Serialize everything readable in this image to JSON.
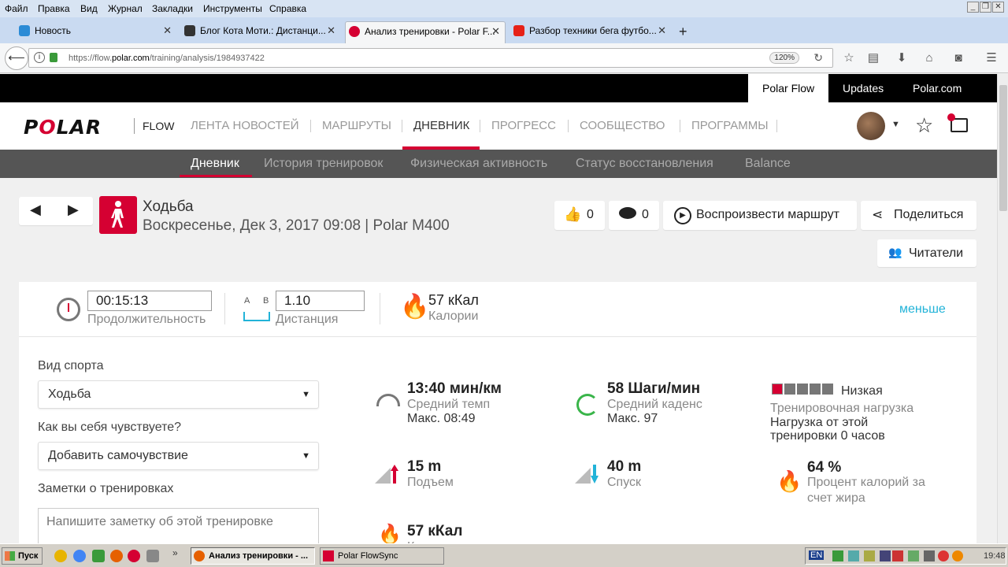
{
  "browser": {
    "menu": [
      "Файл",
      "Правка",
      "Вид",
      "Журнал",
      "Закладки",
      "Инструменты",
      "Справка"
    ],
    "tabs": [
      {
        "label": "Новость",
        "icon": "news-icon"
      },
      {
        "label": "Блог Кота Моти.: Дистанци...",
        "icon": "blog-icon"
      },
      {
        "label": "Анализ тренировки - Polar F...",
        "icon": "polar-icon"
      },
      {
        "label": "Разбор техники бега футбо...",
        "icon": "youtube-icon"
      }
    ],
    "url_prefix": "https://flow.",
    "url_host": "polar.com",
    "url_path": "/training/analysis/1984937422",
    "zoom": "120%"
  },
  "topbar": {
    "flow": "Polar Flow",
    "updates": "Updates",
    "polar": "Polar.com"
  },
  "nav": {
    "logo": "POLAR",
    "flow": "FLOW",
    "items": [
      "ЛЕНТА НОВОСТЕЙ",
      "МАРШРУТЫ",
      "ДНЕВНИК",
      "ПРОГРЕСС",
      "СООБЩЕСТВО",
      "ПРОГРАММЫ"
    ]
  },
  "subnav": [
    "Дневник",
    "История тренировок",
    "Физическая активность",
    "Статус восстановления",
    "Balance"
  ],
  "session": {
    "sport": "Ходьба",
    "datetime": "Воскресенье, Дек 3, 2017 09:08 | Polar M400",
    "likes": "0",
    "comments": "0",
    "replay": "Воспроизвести маршрут",
    "share": "Поделиться",
    "readers": "Читатели"
  },
  "summary": {
    "duration": "00:15:13",
    "duration_label": "Продолжительность",
    "ab_a": "A",
    "ab_b": "B",
    "distance": "1.10",
    "distance_label": "Дистанция",
    "calories": "57 кКал",
    "calories_label": "Калории",
    "less": "меньше"
  },
  "form": {
    "sport_label": "Вид спорта",
    "sport_value": "Ходьба",
    "feel_label": "Как вы себя чувствуете?",
    "feel_value": "Добавить самочувствие",
    "notes_label": "Заметки о тренировках",
    "notes_placeholder": "Напишите заметку об этой тренировке"
  },
  "stats": {
    "pace": "13:40 мин/км",
    "pace_label": "Средний темп",
    "pace_max": "Макс. 08:49",
    "cadence": "58 Шаги/мин",
    "cadence_label": "Средний каденс",
    "cadence_max": "Макс. 97",
    "load_level": "Низкая",
    "load_label": "Тренировочная нагрузка",
    "load_text1": "Нагрузка от этой",
    "load_text2": "тренировки 0 часов",
    "ascent": "15 m",
    "ascent_label": "Подъем",
    "descent": "40 m",
    "descent_label": "Спуск",
    "fat": "64 %",
    "fat_label1": "Процент калорий за",
    "fat_label2": "счет жира",
    "kcal": "57 кКал",
    "kcal_label": "Калории"
  },
  "taskbar": {
    "start": "Пуск",
    "task1": "Анализ тренировки - ...",
    "task2": "Polar FlowSync",
    "lang": "EN",
    "time": "19:48"
  },
  "colors": {
    "accent": "#d50032",
    "link": "#22b3d8"
  }
}
